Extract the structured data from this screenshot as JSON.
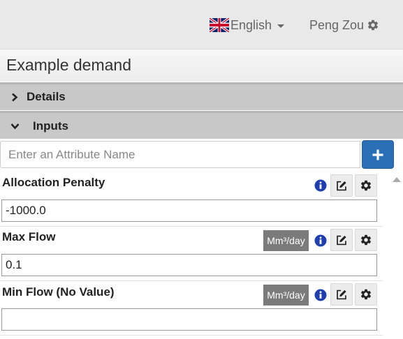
{
  "header": {
    "language": "English",
    "user_name": "Peng Zou"
  },
  "page": {
    "title": "Example demand"
  },
  "sections": {
    "details": "Details",
    "inputs": "Inputs"
  },
  "attribute_search": {
    "placeholder": "Enter an Attribute Name",
    "add_label": "+"
  },
  "attributes": [
    {
      "name": "Allocation Penalty",
      "unit": "",
      "value": "-1000.0"
    },
    {
      "name": "Max Flow",
      "unit": "Mm³/day",
      "value": "0.1"
    },
    {
      "name": "Min Flow (No Value)",
      "unit": "Mm³/day",
      "value": ""
    }
  ],
  "colors": {
    "accent": "#2a6fb5",
    "info_icon": "#1f3fb0",
    "section_bg": "#c8c8c8",
    "unit_badge": "#7b7b7b"
  }
}
